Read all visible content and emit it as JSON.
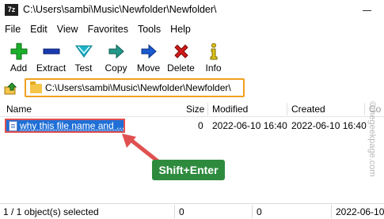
{
  "window": {
    "app_icon_text": "7z",
    "title": "C:\\Users\\sambi\\Music\\Newfolder\\Newfolder\\"
  },
  "menu": [
    "File",
    "Edit",
    "View",
    "Favorites",
    "Tools",
    "Help"
  ],
  "toolbar": [
    {
      "label": "Add",
      "icon": "add-icon",
      "color": "#1bb02b"
    },
    {
      "label": "Extract",
      "icon": "extract-icon",
      "color": "#1a3bb0"
    },
    {
      "label": "Test",
      "icon": "test-icon",
      "color": "#1ab3c8"
    },
    {
      "label": "Copy",
      "icon": "copy-icon",
      "color": "#23988a"
    },
    {
      "label": "Move",
      "icon": "move-icon",
      "color": "#1a5bd0"
    },
    {
      "label": "Delete",
      "icon": "delete-icon",
      "color": "#d21a1a"
    },
    {
      "label": "Info",
      "icon": "info-icon",
      "color": "#e0c418"
    }
  ],
  "address": {
    "path": "C:\\Users\\sambi\\Music\\Newfolder\\Newfolder\\"
  },
  "columns": [
    "Name",
    "Size",
    "Modified",
    "Created",
    "Co"
  ],
  "files": [
    {
      "name": "why this file name and ...",
      "size": "0",
      "modified": "2022-06-10 16:40",
      "created": "2022-06-10 16:40"
    }
  ],
  "annotation": {
    "label": "Shift+Enter"
  },
  "watermark": "©thegeekpage.com",
  "status": {
    "selection": "1 / 1 object(s) selected",
    "size1": "0",
    "size2": "0",
    "date": "2022-06-10"
  },
  "colors": {
    "selection": "#1f6fd6",
    "highlight_border": "#f0a020",
    "annotation": "#2e8b3e",
    "arrow": "#e05050"
  }
}
